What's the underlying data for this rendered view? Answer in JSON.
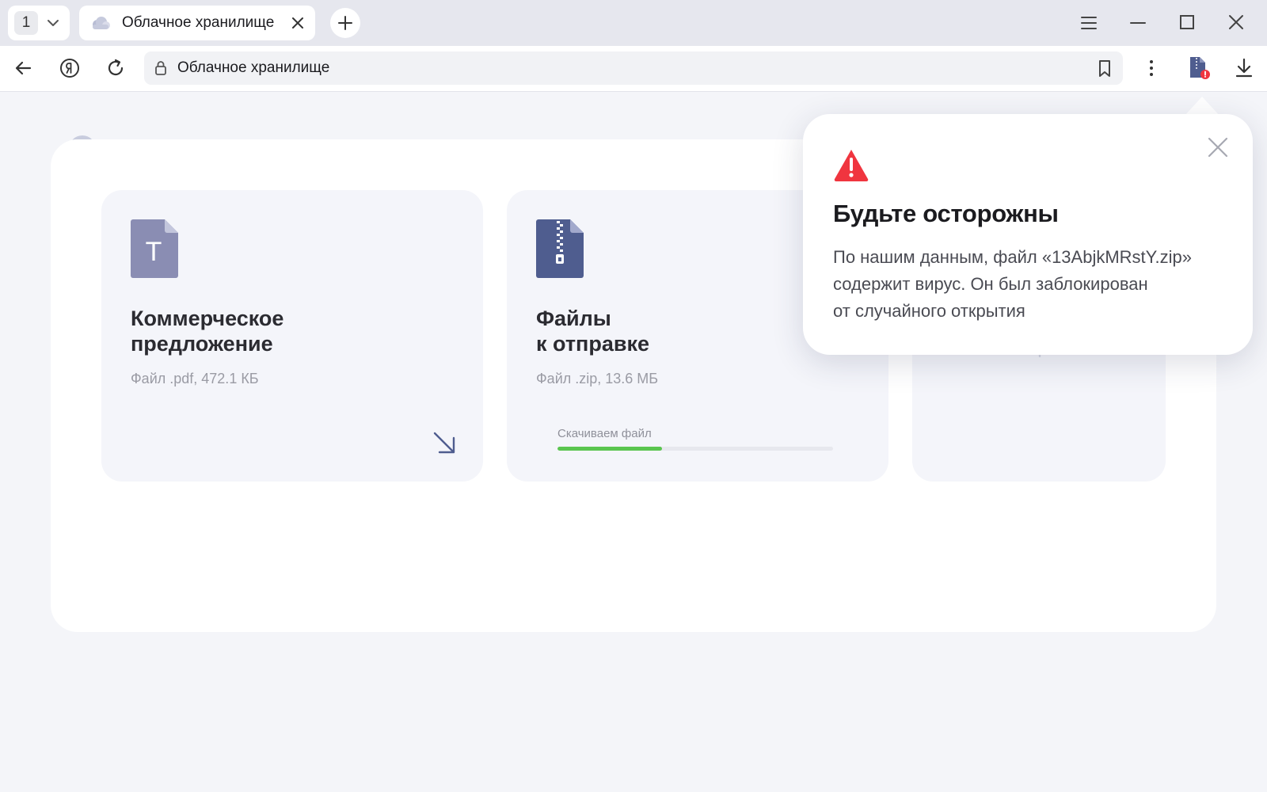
{
  "tabs": {
    "count": "1",
    "active": {
      "title": "Облачное хранилище"
    }
  },
  "address_bar": {
    "url_text": "Облачное хранилище"
  },
  "page": {
    "cards": [
      {
        "icon_letter": "T",
        "title_line1": "Коммерческое",
        "title_line2": "предложение",
        "meta": "Файл .pdf, 472.1 КБ"
      },
      {
        "title_line1": "Файлы",
        "title_line2": "к отправке",
        "meta": "Файл .zip, 13.6 МБ",
        "progress_label": "Скачиваем файл",
        "progress_fraction": 0.38
      }
    ]
  },
  "popup": {
    "heading": "Будьте осторожны",
    "line1": "По нашим данным, файл «13AbjkMRstY.zip»",
    "line2": "содержит вирус. Он был заблокирован",
    "line3": "от случайного открытия"
  },
  "colors": {
    "accent_warning": "#f0353f",
    "progress": "#5ac54f",
    "pdf_icon": "#8a8db3",
    "zip_icon": "#4f5d8f"
  },
  "icons": [
    "cloud-icon",
    "chevron-down-icon",
    "close-icon",
    "plus-icon",
    "menu-icon",
    "minimize-icon",
    "maximize-icon",
    "back-icon",
    "yandex-icon",
    "reload-icon",
    "lock-icon",
    "bookmark-icon",
    "more-icon",
    "zip-alert-icon",
    "download-icon",
    "arrow-down-right-icon",
    "warning-icon"
  ]
}
